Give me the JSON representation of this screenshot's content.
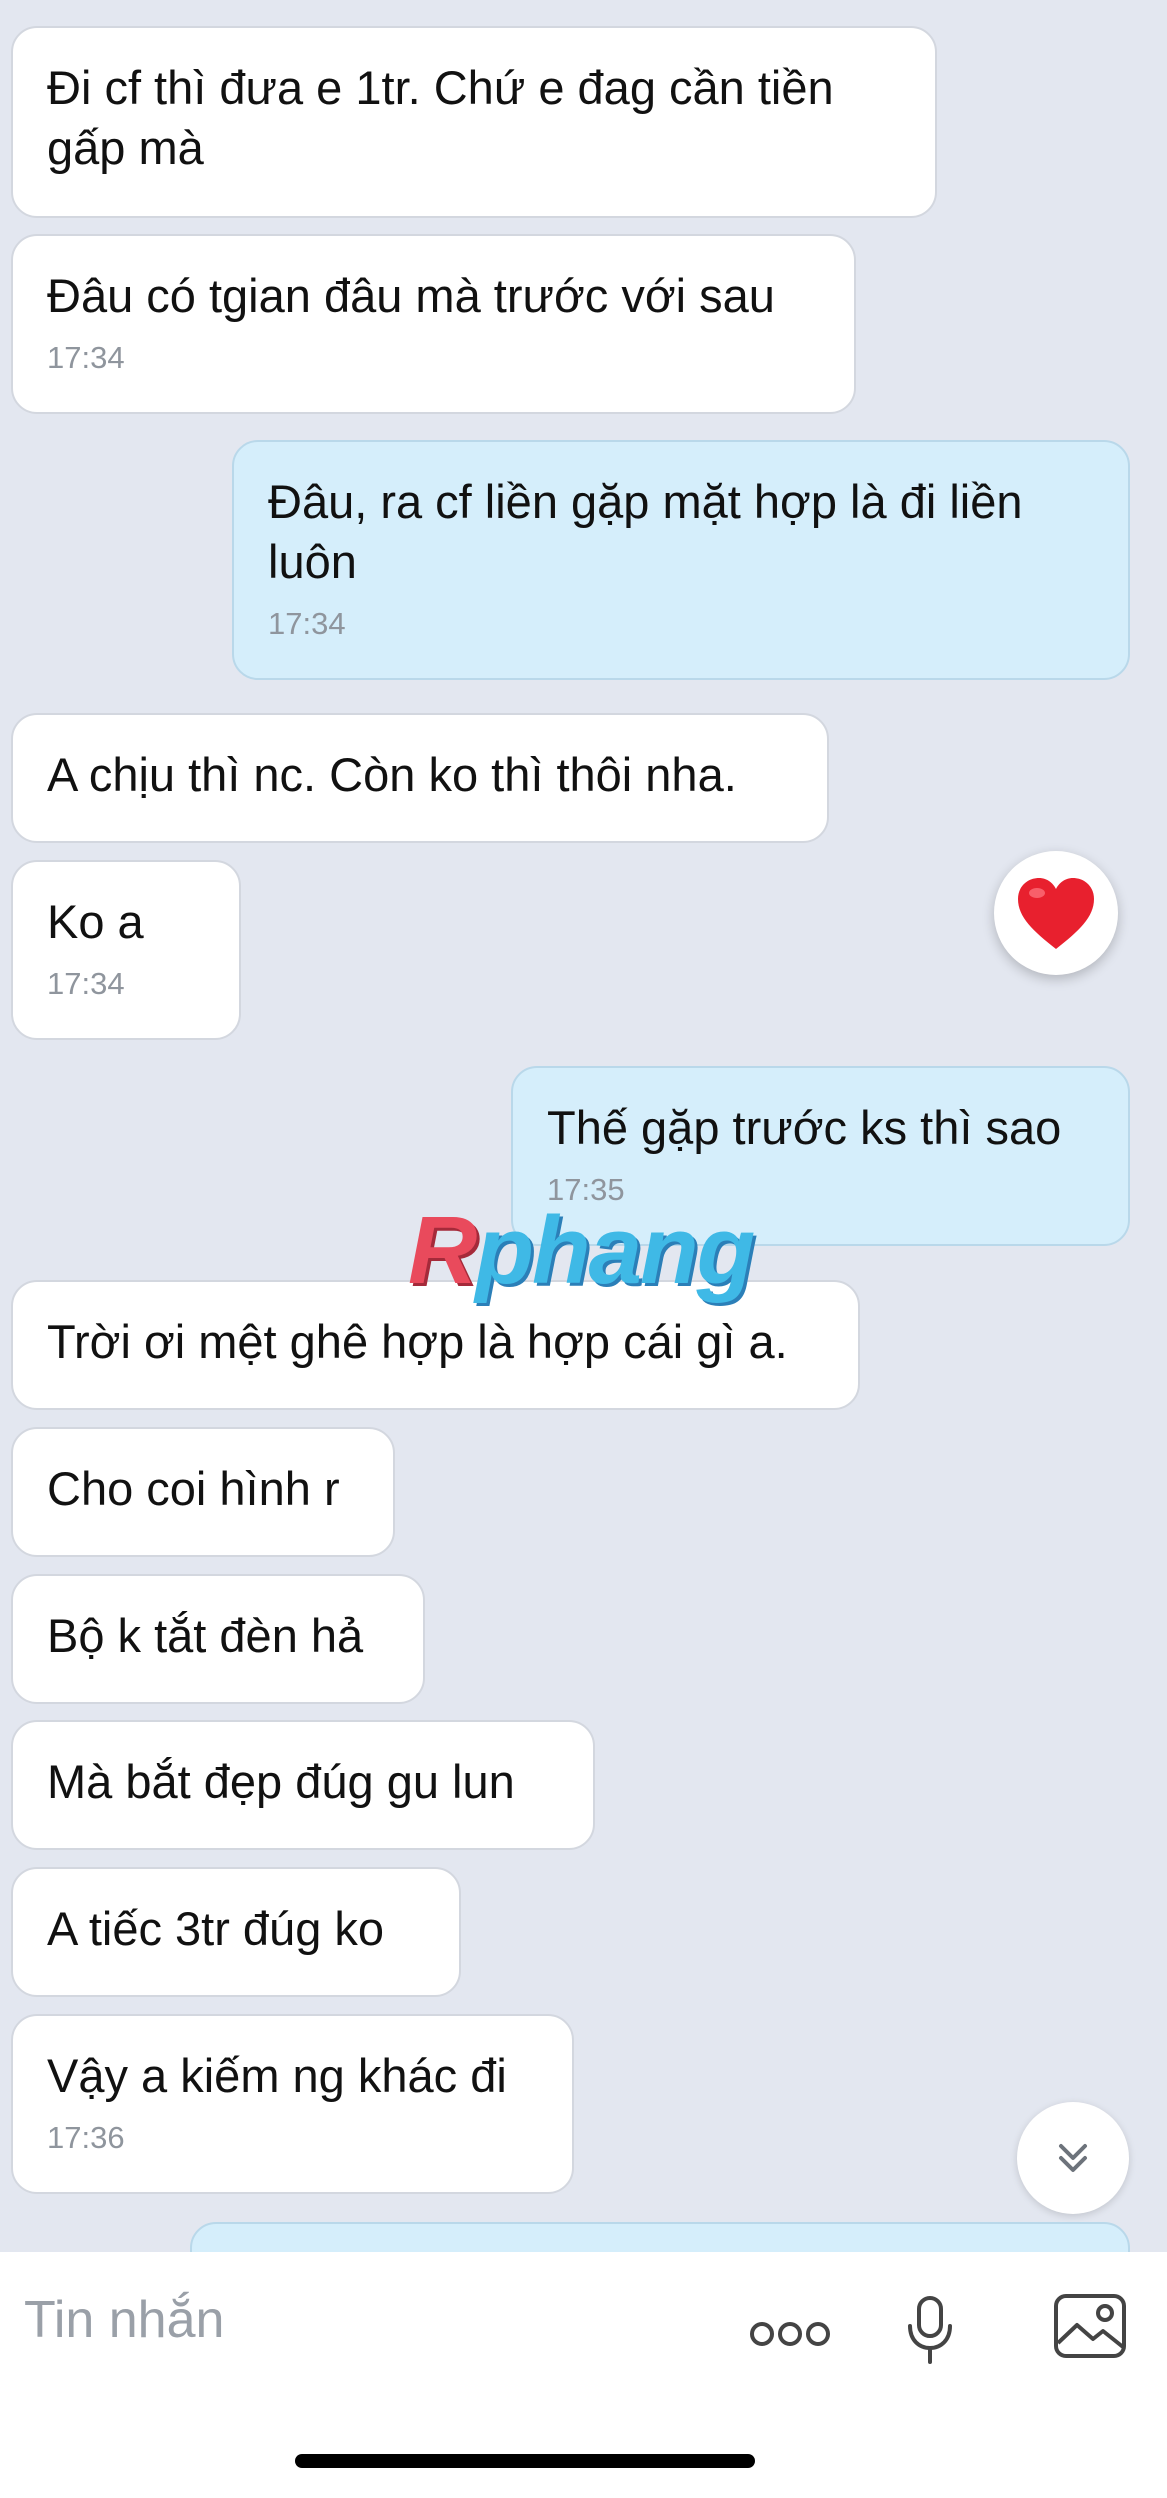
{
  "messages": [
    {
      "text": "Đi cf thì đưa e 1tr. Chứ e đag cần tiền\ngấp mà",
      "time": ""
    },
    {
      "text": "Đâu có tgian đâu mà trước với sau",
      "time": "17:34"
    },
    {
      "text": "Đâu, ra cf liền gặp mặt hợp là đi liền\nluôn",
      "time": "17:34"
    },
    {
      "text": "A chịu thì nc. Còn ko thì thôi nha.",
      "time": ""
    },
    {
      "text": "Ko a",
      "time": "17:34"
    },
    {
      "text": "Thế gặp trước ks thì sao",
      "time": "17:35"
    },
    {
      "text": "Trời ơi mệt ghê hợp là hợp cái gì a.",
      "time": ""
    },
    {
      "text": "Cho coi hình r",
      "time": ""
    },
    {
      "text": "Bộ k tắt đèn hả",
      "time": ""
    },
    {
      "text": "Mà bắt đẹp đúg gu lun",
      "time": ""
    },
    {
      "text": "A tiếc 3tr đúg ko",
      "time": ""
    },
    {
      "text": "Vậy a kiếm ng khác đi",
      "time": "17:36"
    }
  ],
  "reaction": {
    "icon": "heart-icon",
    "color": "#e8202e"
  },
  "watermark": {
    "first": "R",
    "rest": "phang"
  },
  "composer": {
    "placeholder": "Tin nhắn",
    "more_icon": "more-dots-icon",
    "mic_icon": "microphone-icon",
    "image_icon": "image-icon"
  },
  "colors": {
    "background": "#e3e7f0",
    "incoming": "#ffffff",
    "outgoing": "#d5eefb"
  }
}
